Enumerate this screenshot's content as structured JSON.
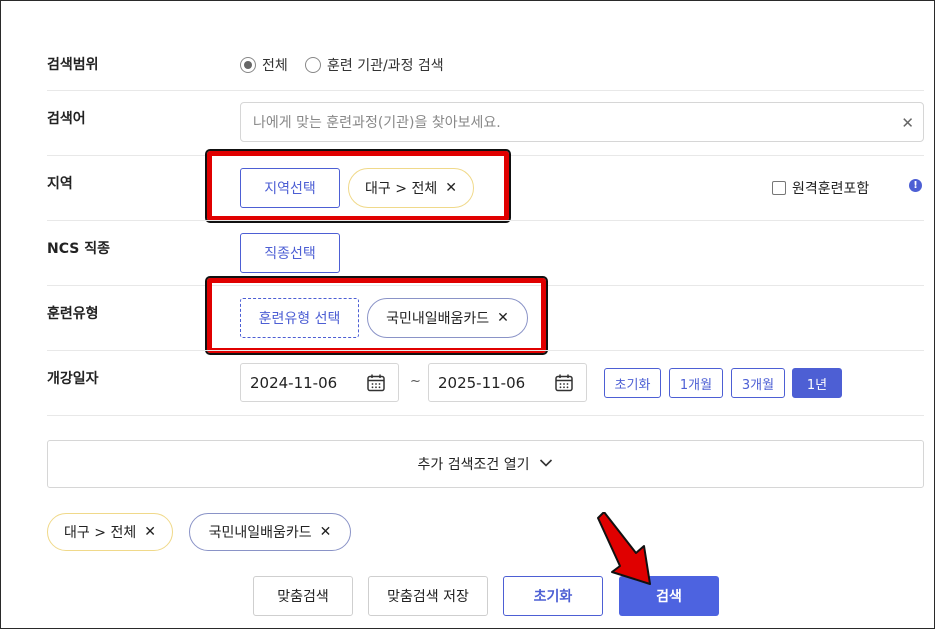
{
  "search_scope": {
    "label": "검색범위",
    "options": [
      "전체",
      "훈련 기관/과정 검색"
    ],
    "selected": "전체"
  },
  "keyword": {
    "label": "검색어",
    "placeholder": "나에게 맞는 훈련과정(기관)을 찾아보세요.",
    "clear_icon": "close-icon"
  },
  "region": {
    "label": "지역",
    "select_button": "지역선택",
    "chip": "대구 > 전체",
    "remote_checkbox": "원격훈련포함",
    "remote_checked": false,
    "info_icon": "info-icon"
  },
  "ncs": {
    "label": "NCS 직종",
    "select_button": "직종선택"
  },
  "training_type": {
    "label": "훈련유형",
    "select_button": "훈련유형 선택",
    "chip": "국민내일배움카드"
  },
  "start_date": {
    "label": "개강일자",
    "from": "2024-11-06",
    "to": "2025-11-06",
    "separator": "~",
    "periods": [
      "초기화",
      "1개월",
      "3개월",
      "1년"
    ],
    "active_period": "1년"
  },
  "more_conditions": {
    "label": "추가 검색조건 열기",
    "icon": "chevron-down-icon"
  },
  "selected_chips": [
    "대구 > 전체",
    "국민내일배움카드"
  ],
  "actions": {
    "custom_search": "맞춤검색",
    "save_custom_search": "맞춤검색 저장",
    "reset": "초기화",
    "search": "검색"
  },
  "colors": {
    "accent": "#4d5fd4",
    "primary_button": "#4d63e0",
    "highlight_box": "#e00000",
    "chip_yellow_border": "#f0d98a"
  }
}
